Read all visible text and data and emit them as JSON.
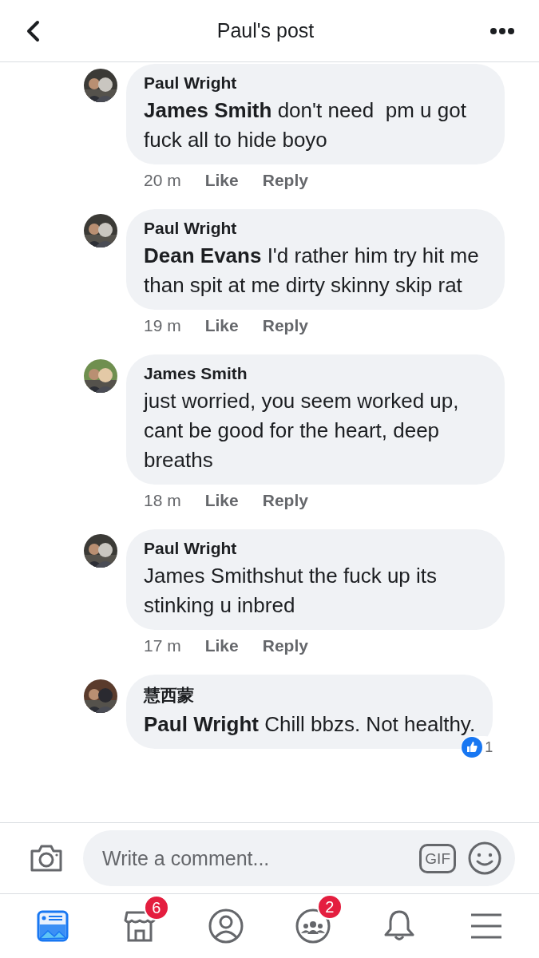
{
  "header": {
    "title": "Paul's post"
  },
  "comments": [
    {
      "author": "Paul Wright",
      "text": "**James Smith** don't need  pm u got fuck all to hide boyo",
      "time": "20 m",
      "actions": [
        "Like",
        "Reply"
      ]
    },
    {
      "author": "Paul Wright",
      "text": "**Dean Evans** I'd rather him try hit me than spit at me dirty skinny skip rat",
      "time": "19 m",
      "actions": [
        "Like",
        "Reply"
      ]
    },
    {
      "author": "James Smith",
      "text": "just worried, you seem worked up, cant be good for the heart, deep breaths",
      "time": "18 m",
      "actions": [
        "Like",
        "Reply"
      ]
    },
    {
      "author": "Paul Wright",
      "text": "James Smithshut the fuck up its stinking u inbred",
      "time": "17 m",
      "actions": [
        "Like",
        "Reply"
      ]
    },
    {
      "author": "慧西蒙",
      "text": "**Paul Wright** Chill bbzs. Not healthy.",
      "reaction": {
        "count": "1"
      }
    }
  ],
  "composer": {
    "placeholder": "Write a comment...",
    "gif": "GIF"
  },
  "tabs": [
    {
      "kind": "feed",
      "selected": true
    },
    {
      "kind": "marketplace",
      "selected": false,
      "badge": "6"
    },
    {
      "kind": "profile",
      "selected": false
    },
    {
      "kind": "groups",
      "selected": false,
      "badge": "2"
    },
    {
      "kind": "notifications",
      "selected": false
    },
    {
      "kind": "menu",
      "selected": false
    }
  ]
}
